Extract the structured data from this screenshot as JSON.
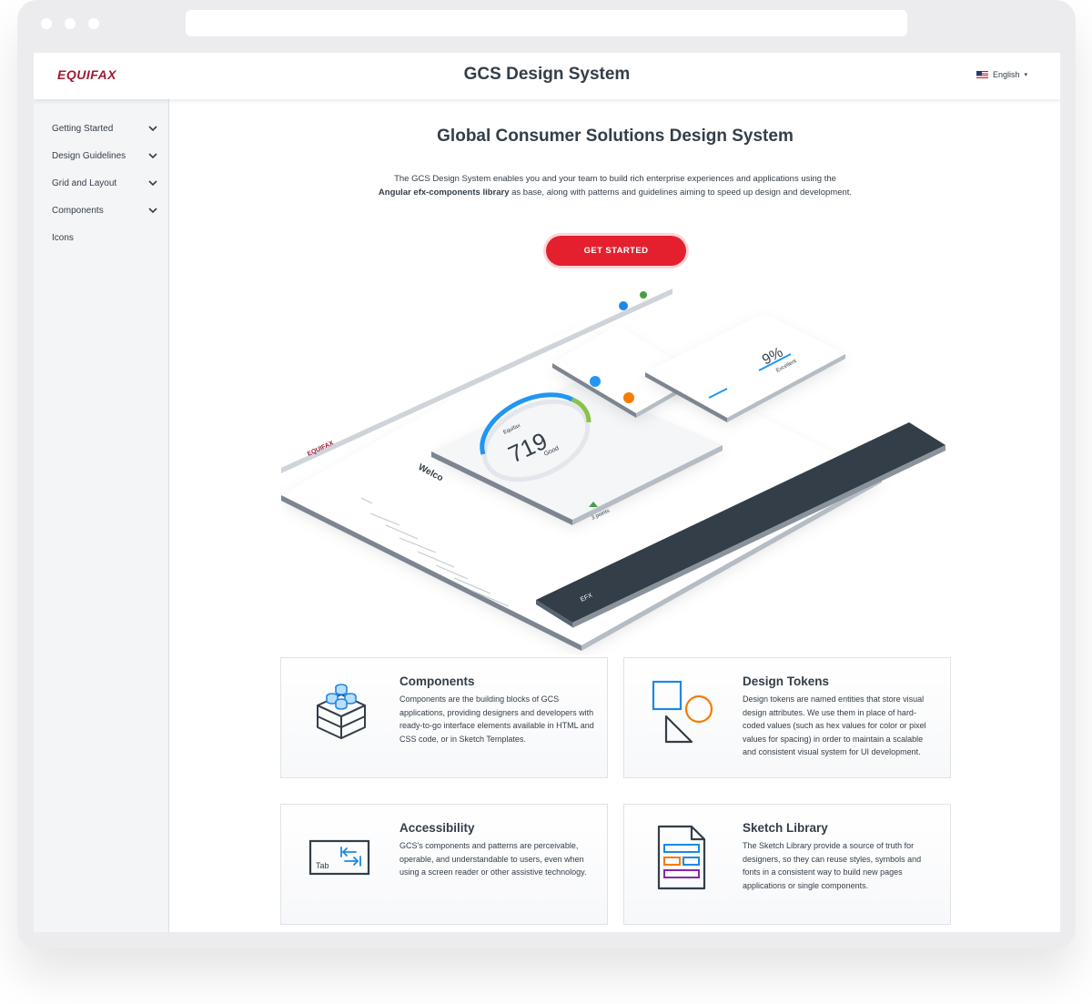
{
  "header": {
    "logo": "EQUIFAX",
    "title": "GCS Design System",
    "language": "English"
  },
  "sidebar": {
    "items": [
      {
        "label": "Getting Started",
        "has_children": true
      },
      {
        "label": "Design Guidelines",
        "has_children": true
      },
      {
        "label": "Grid and Layout",
        "has_children": true
      },
      {
        "label": "Components",
        "has_children": true
      },
      {
        "label": "Icons",
        "has_children": false
      }
    ]
  },
  "hero": {
    "title": "Global Consumer Solutions Design System",
    "desc_line1": "The GCS Design System enables you and your team to build rich enterprise experiences and applications using the",
    "desc_bold": "Angular efx-components library",
    "desc_line2_rest": " as base, along with patterns and guidelines aiming to speed up design and development.",
    "cta_label": "GET STARTED"
  },
  "illustration": {
    "score": "719",
    "score_word": "Good",
    "brand": "Equifax",
    "utilization": "9%",
    "utilization_word": "Excellent",
    "welcome": "Welco",
    "points": "3 points",
    "footer_brand": "EFX"
  },
  "cards": [
    {
      "title": "Components",
      "text": "Components are the building blocks of GCS applications, providing designers and developers with ready-to-go interface elements available in HTML and CSS code, or in Sketch Templates.",
      "icon": "blocks-icon"
    },
    {
      "title": "Design Tokens",
      "text": "Design tokens are named entities that store visual design attributes. We use them in place of hard-coded values (such as hex values for color or pixel values for spacing) in order to maintain a scalable and consistent visual system for UI development.",
      "icon": "shapes-icon"
    },
    {
      "title": "Accessibility",
      "text": "GCS's components and patterns are perceivable, operable, and understandable to users, even when using a screen reader or other assistive technology.",
      "icon": "tab-key-icon",
      "key_label": "Tab"
    },
    {
      "title": "Sketch Library",
      "text": "The Sketch Library provide a source of truth for designers, so they can reuse styles, symbols and fonts in a consistent way to build new pages applications or single components.",
      "icon": "document-icon"
    }
  ],
  "colors": {
    "brand_red": "#9e1b32",
    "cta_red": "#e4202f",
    "text": "#333e48",
    "icon_blue": "#1e88e5",
    "icon_orange": "#f57c00",
    "icon_purple": "#8e24aa"
  }
}
